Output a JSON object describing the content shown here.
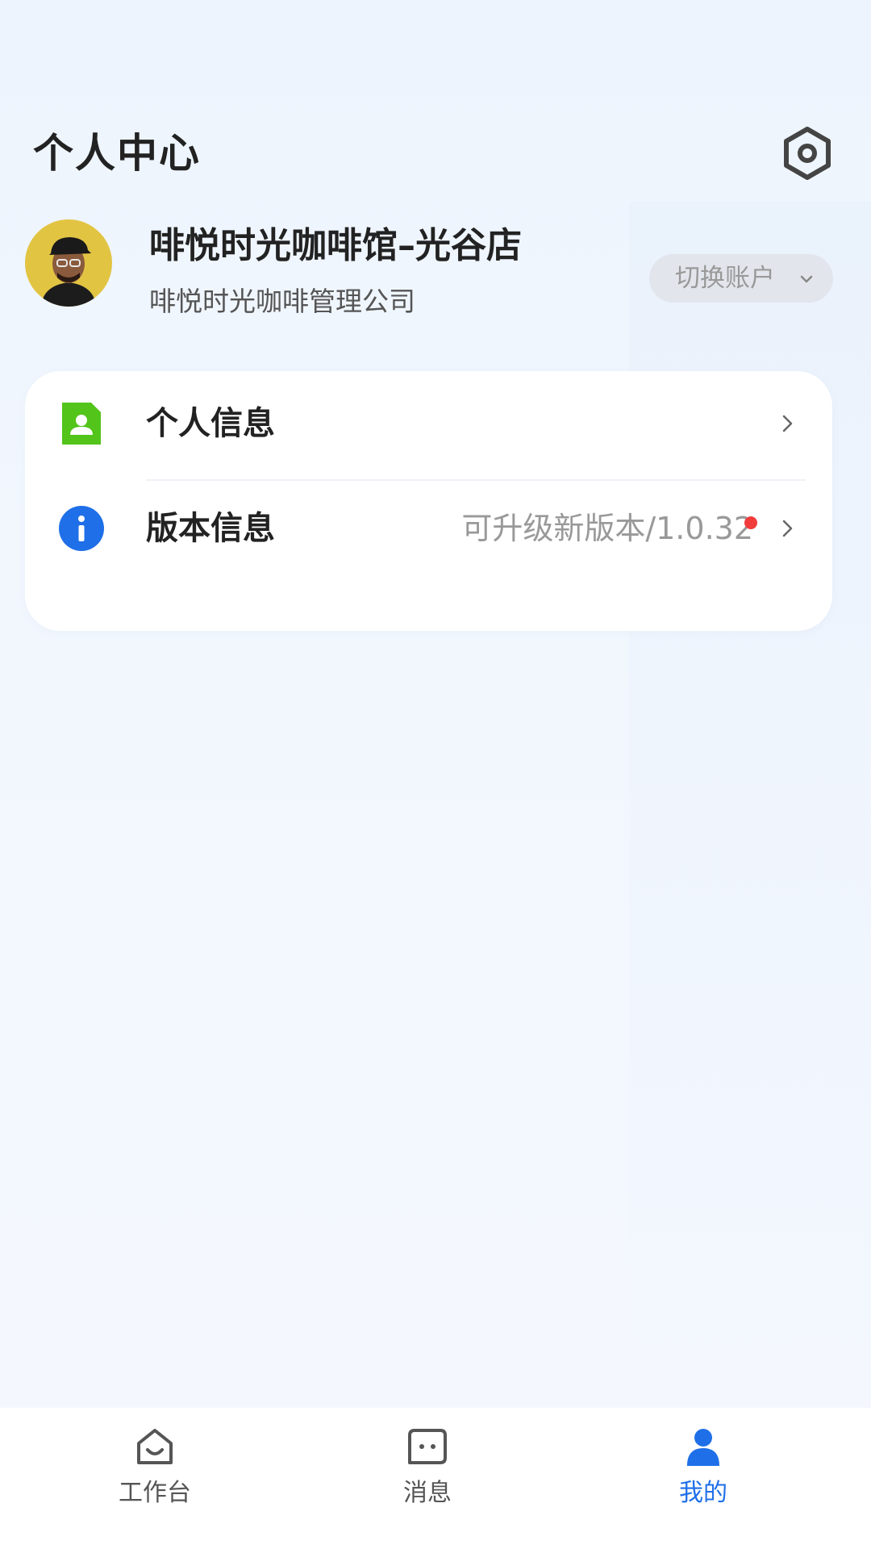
{
  "header": {
    "title": "个人中心",
    "settings_icon": "gear-icon"
  },
  "profile": {
    "org_name": "啡悦时光咖啡馆–光谷店",
    "company": "啡悦时光咖啡管理公司",
    "switch_account_label": "切换账户",
    "avatar_icon": "user-avatar"
  },
  "menu": {
    "items": [
      {
        "label": "个人信息",
        "icon": "id-card-icon",
        "icon_color": "#52c41a"
      },
      {
        "label": "版本信息",
        "icon": "info-icon",
        "icon_color": "#1f6fe8",
        "value": "可升级新版本/1.0.32",
        "has_badge": true
      }
    ]
  },
  "tabbar": {
    "tabs": [
      {
        "label": "工作台",
        "icon": "home-icon",
        "active": false
      },
      {
        "label": "消息",
        "icon": "message-icon",
        "active": false
      },
      {
        "label": "我的",
        "icon": "person-icon",
        "active": true
      }
    ]
  },
  "colors": {
    "accent": "#1f6fe8",
    "badge": "#f23c3c",
    "background": "#f2f7fe"
  }
}
